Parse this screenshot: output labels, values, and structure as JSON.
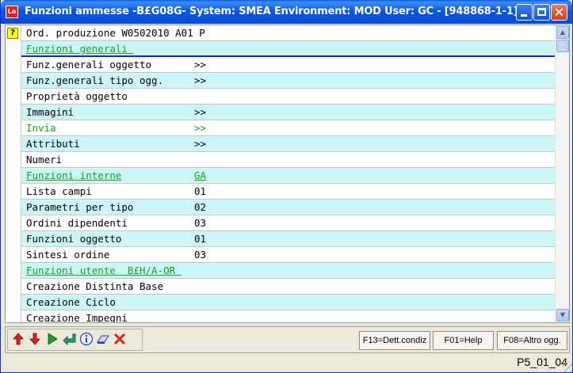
{
  "window": {
    "title": "Funzioni ammesse -B£G08G- System: SMEA Environment: MOD User: GC - [948868-1-1]",
    "icon_text": "Lo"
  },
  "list": {
    "header": "Ord. produzione W0502010 A01 P",
    "help_icon": "?",
    "rows": [
      {
        "c1": "Funzioni generali ",
        "c2": ""
      },
      {
        "c1": "Funz.generali oggetto",
        "c2": ">>"
      },
      {
        "c1": "Funz.generali tipo ogg.",
        "c2": ">>"
      },
      {
        "c1": "Proprietà oggetto",
        "c2": ""
      },
      {
        "c1": "Immagini",
        "c2": ">>"
      },
      {
        "c1": "Invia",
        "c2": ">>"
      },
      {
        "c1": "Attributi",
        "c2": ">>"
      },
      {
        "c1": "Numeri",
        "c2": ""
      },
      {
        "c1": "Funzioni interne",
        "c2": "GA"
      },
      {
        "c1": "Lista campi",
        "c2": "01"
      },
      {
        "c1": "Parametri per tipo",
        "c2": "02"
      },
      {
        "c1": "Ordini dipendenti",
        "c2": "03"
      },
      {
        "c1": "Funzioni oggetto",
        "c2": "01"
      },
      {
        "c1": "Sintesi ordine",
        "c2": "03"
      },
      {
        "c1": "Funzioni utente  B£H/A-OR ",
        "c2": ""
      },
      {
        "c1": "Creazione Distinta Base",
        "c2": ""
      },
      {
        "c1": "Creazione Ciclo",
        "c2": ""
      },
      {
        "c1": "Creazione Impegni",
        "c2": ""
      }
    ]
  },
  "toolbar": {
    "f13_label": "F13=Dett.condiz",
    "f01_label": "F01=Help",
    "f08_label": "F08=Altro ogg."
  },
  "status": {
    "code": "P5_01_04"
  },
  "colors": {
    "green_text": "#1aa01a",
    "cyan_row": "#ccf5f8"
  }
}
